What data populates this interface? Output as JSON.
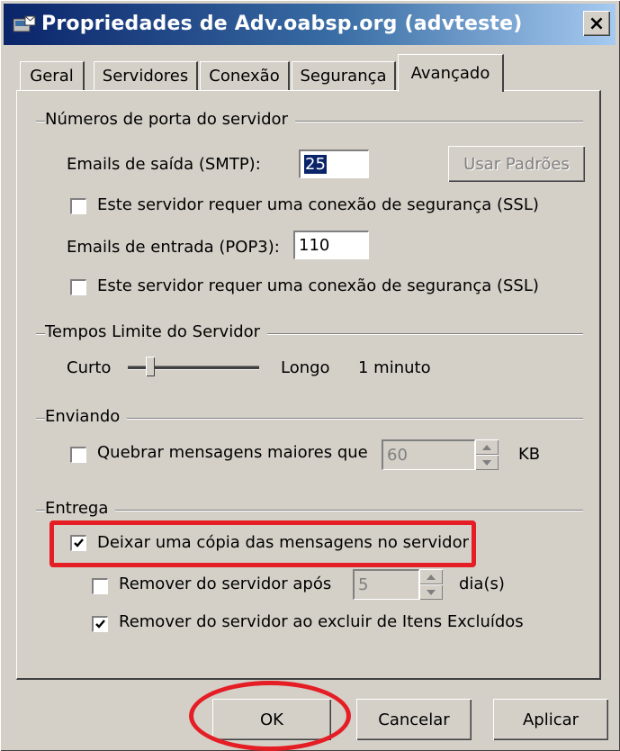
{
  "window": {
    "title": "Propriedades de Adv.oabsp.org (advteste)",
    "close_label": "×"
  },
  "tabs": [
    {
      "label": "Geral"
    },
    {
      "label": "Servidores"
    },
    {
      "label": "Conexão"
    },
    {
      "label": "Segurança"
    },
    {
      "label": "Avançado",
      "active": true
    }
  ],
  "ports": {
    "group_label": "Números de porta do servidor",
    "smtp_label": "Emails de saída (SMTP):",
    "smtp_value": "25",
    "use_defaults_label": "Usar Padrões",
    "ssl_label": "Este servidor requer uma conexão de segurança (SSL)",
    "smtp_ssl_checked": false,
    "pop3_label": "Emails de entrada (POP3):",
    "pop3_value": "110",
    "pop3_ssl_checked": false
  },
  "timeouts": {
    "group_label": "Tempos Limite do Servidor",
    "short_label": "Curto",
    "long_label": "Longo",
    "value_label": "1 minuto"
  },
  "sending": {
    "group_label": "Enviando",
    "split_label": "Quebrar mensagens maiores que",
    "split_checked": false,
    "split_value": "60",
    "unit": "KB"
  },
  "delivery": {
    "group_label": "Entrega",
    "leave_copy_label": "Deixar uma cópia das mensagens no servidor",
    "leave_copy_checked": true,
    "remove_after_label": "Remover do servidor após",
    "remove_after_checked": false,
    "remove_after_value": "5",
    "days_label": "dia(s)",
    "remove_deleted_label": "Remover do servidor ao excluir de Itens Excluídos",
    "remove_deleted_checked": true
  },
  "buttons": {
    "ok": "OK",
    "cancel": "Cancelar",
    "apply": "Aplicar"
  },
  "annotation_color": "#e51d25"
}
